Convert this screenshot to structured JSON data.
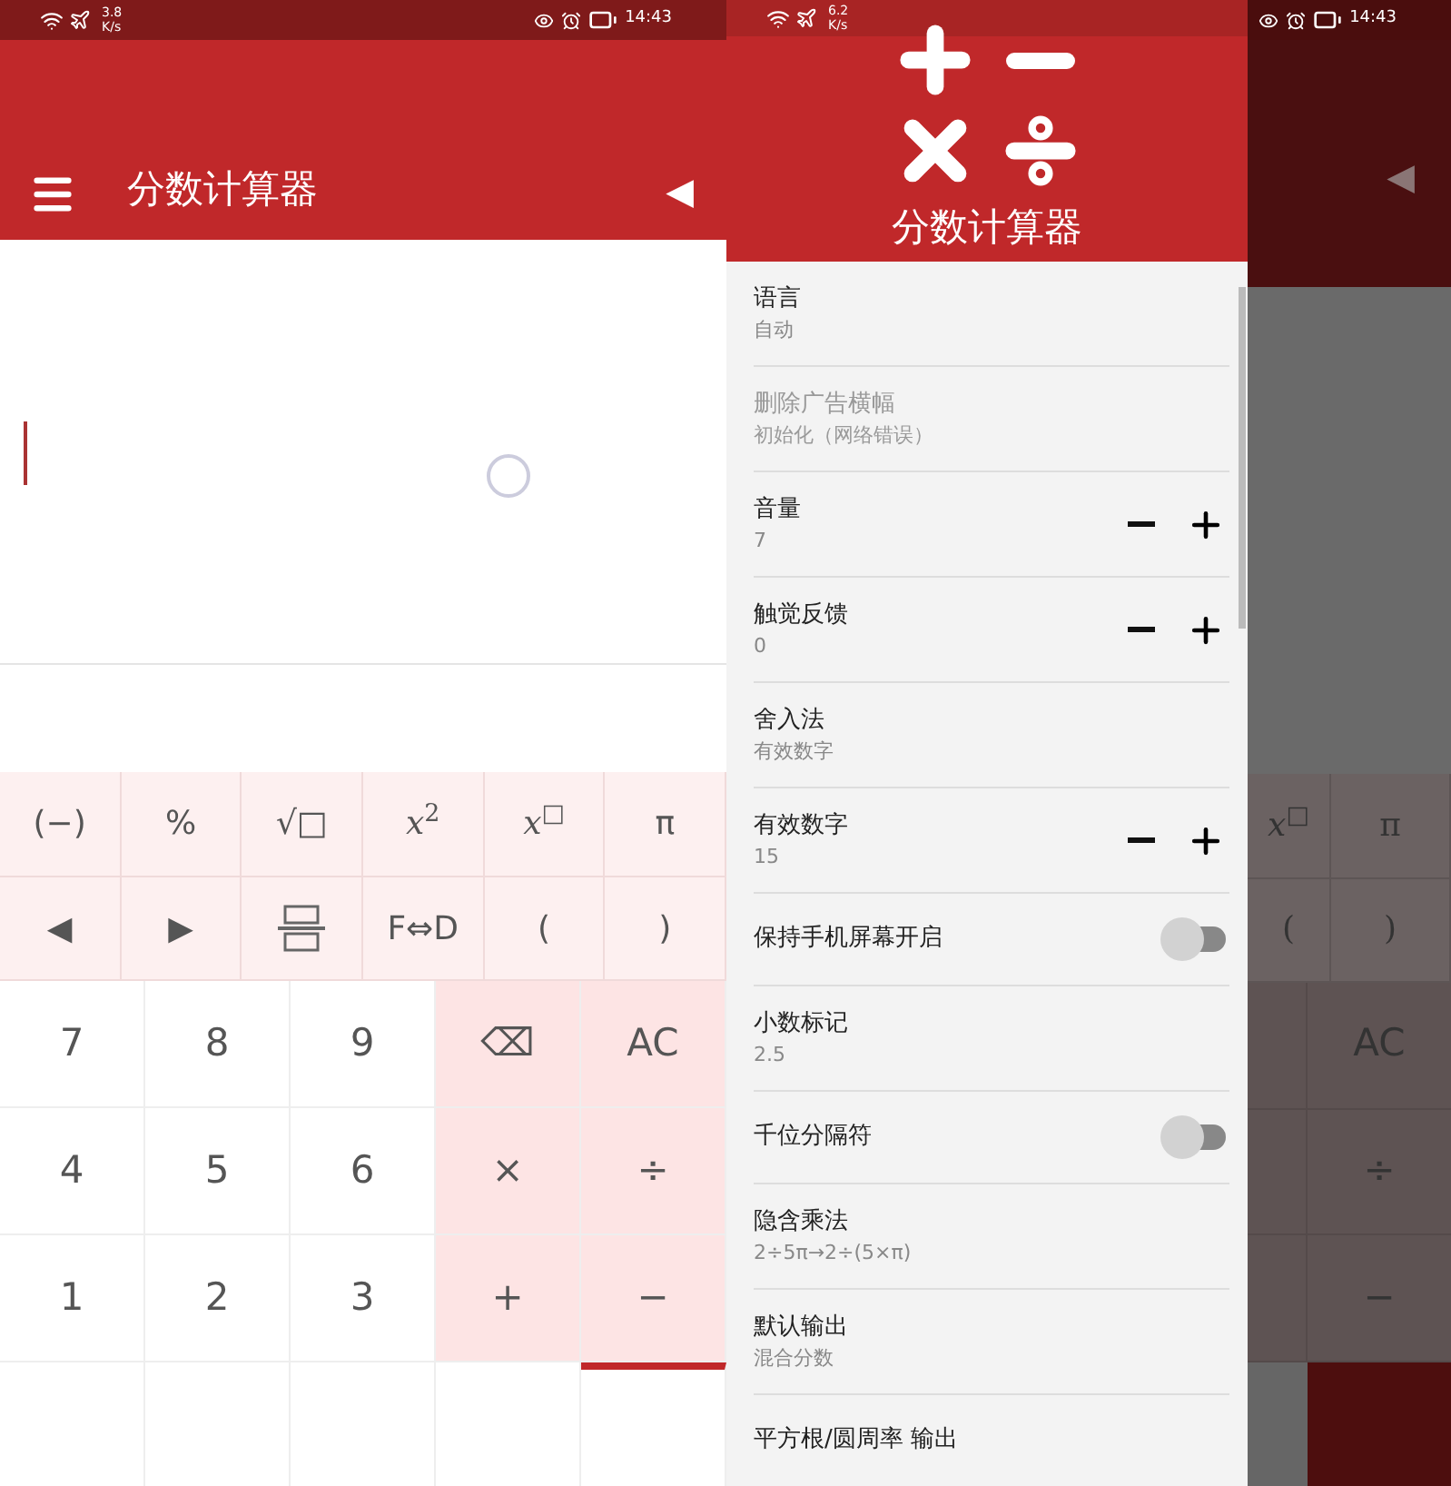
{
  "left_screen": {
    "status_bar": {
      "speed": "3.8",
      "unit": "K/s",
      "time": "14:43"
    },
    "toolbar": {
      "title": "分数计算器",
      "back": "◀"
    },
    "function_rows": [
      [
        {
          "kind": "text",
          "label": "(−)"
        },
        {
          "kind": "text",
          "label": "%"
        },
        {
          "kind": "text",
          "label": "√□"
        },
        {
          "kind": "math",
          "label": "*x*$^{2}$"
        },
        {
          "kind": "math",
          "label": "*x*$^{□}$"
        },
        {
          "kind": "text",
          "label": "π"
        }
      ],
      [
        {
          "kind": "text",
          "label": "◀"
        },
        {
          "kind": "text",
          "label": "▶"
        },
        {
          "kind": "fraction"
        },
        {
          "kind": "text",
          "label": "F⇔D"
        },
        {
          "kind": "text",
          "label": "("
        },
        {
          "kind": "text",
          "label": ")"
        }
      ]
    ],
    "number_rows": [
      [
        {
          "kind": "digit",
          "label": "7"
        },
        {
          "kind": "digit",
          "label": "8"
        },
        {
          "kind": "digit",
          "label": "9"
        },
        {
          "kind": "operator",
          "label": "⌫"
        },
        {
          "kind": "operator",
          "label": "AC"
        }
      ],
      [
        {
          "kind": "digit",
          "label": "4"
        },
        {
          "kind": "digit",
          "label": "5"
        },
        {
          "kind": "digit",
          "label": "6"
        },
        {
          "kind": "operator",
          "label": "×"
        },
        {
          "kind": "operator",
          "label": "÷"
        }
      ],
      [
        {
          "kind": "digit",
          "label": "1"
        },
        {
          "kind": "digit",
          "label": "2"
        },
        {
          "kind": "digit",
          "label": "3"
        },
        {
          "kind": "operator",
          "label": "+"
        },
        {
          "kind": "operator",
          "label": "−"
        }
      ],
      [
        {
          "kind": "digit"
        },
        {
          "kind": "digit"
        },
        {
          "kind": "digit"
        },
        {
          "kind": "digit"
        },
        {
          "kind": "equals"
        }
      ]
    ]
  },
  "right_screen": {
    "status_bar": {
      "speed": "6.2",
      "unit": "K/s",
      "time": "14:43"
    },
    "drawer": {
      "title": "分数计算器",
      "items": [
        {
          "kind": "text",
          "title": "语言",
          "subtitle": "自动",
          "disabled": false
        },
        {
          "kind": "text",
          "title": "删除广告横幅",
          "subtitle": "初始化（网络错误）",
          "disabled": true
        },
        {
          "kind": "stepper",
          "title": "音量",
          "subtitle": "7"
        },
        {
          "kind": "stepper",
          "title": "触觉反馈",
          "subtitle": "0"
        },
        {
          "kind": "text",
          "title": "舍入法",
          "subtitle": "有效数字",
          "disabled": false
        },
        {
          "kind": "stepper",
          "title": "有效数字",
          "subtitle": "15"
        },
        {
          "kind": "toggle",
          "title": "保持手机屏幕开启",
          "on": false
        },
        {
          "kind": "text",
          "title": "小数标记",
          "subtitle": "2.5",
          "disabled": false
        },
        {
          "kind": "toggle",
          "title": "千位分隔符",
          "on": false
        },
        {
          "kind": "text",
          "title": "隐含乘法",
          "subtitle": "2÷5π→2÷(5×π)",
          "disabled": false
        },
        {
          "kind": "text",
          "title": "默认输出",
          "subtitle": "混合分数",
          "disabled": false
        },
        {
          "kind": "text",
          "title": "平方根/圆周率 输出",
          "disabled": false
        }
      ]
    },
    "dimmed_calculator": {
      "back": "◀",
      "function_rows": [
        [
          "*x*$^{□}$",
          "π"
        ],
        [
          "(",
          ")"
        ]
      ],
      "keys": [
        "AC",
        "÷",
        "−"
      ]
    }
  }
}
